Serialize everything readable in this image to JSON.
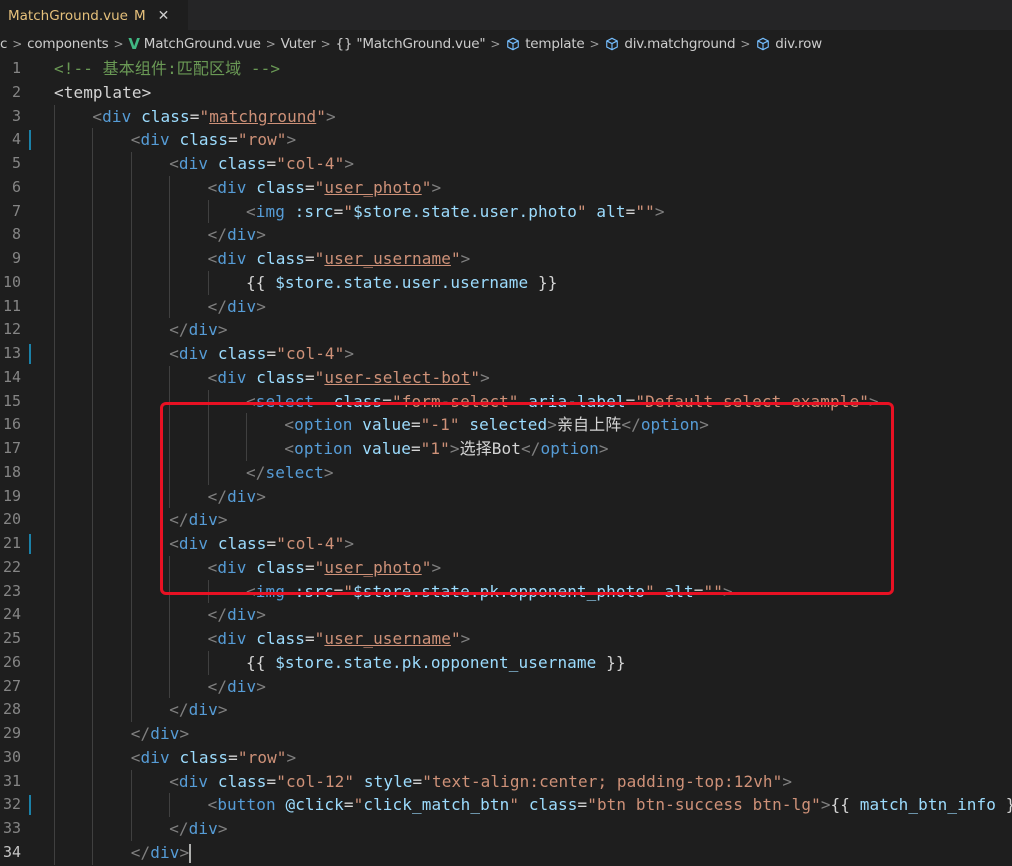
{
  "tab": {
    "title": "MatchGround.vue",
    "modified": "M",
    "close": "✕"
  },
  "breadcrumb": [
    {
      "label": "c",
      "icon": ""
    },
    {
      "label": "components",
      "icon": ""
    },
    {
      "label": "MatchGround.vue",
      "icon": "vue-icon"
    },
    {
      "label": "Vuter",
      "icon": ""
    },
    {
      "label": "\"MatchGround.vue\"",
      "icon": "braces-icon"
    },
    {
      "label": "template",
      "icon": "cube-icon"
    },
    {
      "label": "div.matchground",
      "icon": "cube-icon"
    },
    {
      "label": "div.row",
      "icon": "cube-icon"
    }
  ],
  "highlight_color": "#e81123",
  "active_line": 34,
  "lines": [
    {
      "n": 1,
      "indent": 0,
      "tokens": [
        [
          "comment",
          "<!-- 基本组件:匹配区域 -->"
        ]
      ]
    },
    {
      "n": 2,
      "indent": 0,
      "tokens": [
        [
          "tpl",
          "<template>"
        ]
      ]
    },
    {
      "n": 3,
      "indent": 1,
      "tokens": [
        [
          "bracket",
          "<"
        ],
        [
          "tag",
          "div"
        ],
        [
          "text",
          " "
        ],
        [
          "attr",
          "class"
        ],
        [
          "eq",
          "="
        ],
        [
          "str",
          "\""
        ],
        [
          "strU",
          "matchground"
        ],
        [
          "str",
          "\""
        ],
        [
          "bracket",
          ">"
        ]
      ]
    },
    {
      "n": 4,
      "indent": 2,
      "tokens": [
        [
          "bracket",
          "<"
        ],
        [
          "tag",
          "div"
        ],
        [
          "text",
          " "
        ],
        [
          "attr",
          "class"
        ],
        [
          "eq",
          "="
        ],
        [
          "str",
          "\"row\""
        ],
        [
          "bracket",
          ">"
        ]
      ]
    },
    {
      "n": 5,
      "indent": 3,
      "tokens": [
        [
          "bracket",
          "<"
        ],
        [
          "tag",
          "div"
        ],
        [
          "text",
          " "
        ],
        [
          "attr",
          "class"
        ],
        [
          "eq",
          "="
        ],
        [
          "str",
          "\"col-4\""
        ],
        [
          "bracket",
          ">"
        ]
      ]
    },
    {
      "n": 6,
      "indent": 4,
      "tokens": [
        [
          "bracket",
          "<"
        ],
        [
          "tag",
          "div"
        ],
        [
          "text",
          " "
        ],
        [
          "attr",
          "class"
        ],
        [
          "eq",
          "="
        ],
        [
          "str",
          "\""
        ],
        [
          "strU",
          "user_photo"
        ],
        [
          "str",
          "\""
        ],
        [
          "bracket",
          ">"
        ]
      ]
    },
    {
      "n": 7,
      "indent": 5,
      "tokens": [
        [
          "bracket",
          "<"
        ],
        [
          "tag",
          "img"
        ],
        [
          "text",
          " "
        ],
        [
          "attr",
          ":src"
        ],
        [
          "eq",
          "="
        ],
        [
          "str",
          "\""
        ],
        [
          "attr",
          "$store.state.user.photo"
        ],
        [
          "str",
          "\""
        ],
        [
          "text",
          " "
        ],
        [
          "attr",
          "alt"
        ],
        [
          "eq",
          "="
        ],
        [
          "str",
          "\"\""
        ],
        [
          "bracket",
          ">"
        ]
      ]
    },
    {
      "n": 8,
      "indent": 4,
      "tokens": [
        [
          "bracket",
          "</"
        ],
        [
          "tag",
          "div"
        ],
        [
          "bracket",
          ">"
        ]
      ]
    },
    {
      "n": 9,
      "indent": 4,
      "tokens": [
        [
          "bracket",
          "<"
        ],
        [
          "tag",
          "div"
        ],
        [
          "text",
          " "
        ],
        [
          "attr",
          "class"
        ],
        [
          "eq",
          "="
        ],
        [
          "str",
          "\""
        ],
        [
          "strU",
          "user_username"
        ],
        [
          "str",
          "\""
        ],
        [
          "bracket",
          ">"
        ]
      ]
    },
    {
      "n": 10,
      "indent": 5,
      "tokens": [
        [
          "text",
          "{{ "
        ],
        [
          "attr",
          "$store.state.user.username"
        ],
        [
          "text",
          " }}"
        ]
      ]
    },
    {
      "n": 11,
      "indent": 4,
      "tokens": [
        [
          "bracket",
          "</"
        ],
        [
          "tag",
          "div"
        ],
        [
          "bracket",
          ">"
        ]
      ]
    },
    {
      "n": 12,
      "indent": 3,
      "tokens": [
        [
          "bracket",
          "</"
        ],
        [
          "tag",
          "div"
        ],
        [
          "bracket",
          ">"
        ]
      ]
    },
    {
      "n": 13,
      "indent": 3,
      "tokens": [
        [
          "bracket",
          "<"
        ],
        [
          "tag",
          "div"
        ],
        [
          "text",
          " "
        ],
        [
          "attr",
          "class"
        ],
        [
          "eq",
          "="
        ],
        [
          "str",
          "\"col-4\""
        ],
        [
          "bracket",
          ">"
        ]
      ]
    },
    {
      "n": 14,
      "indent": 4,
      "tokens": [
        [
          "bracket",
          "<"
        ],
        [
          "tag",
          "div"
        ],
        [
          "text",
          " "
        ],
        [
          "attr",
          "class"
        ],
        [
          "eq",
          "="
        ],
        [
          "str",
          "\""
        ],
        [
          "strU",
          "user-select-bot"
        ],
        [
          "str",
          "\""
        ],
        [
          "bracket",
          ">"
        ]
      ]
    },
    {
      "n": 15,
      "indent": 5,
      "tokens": [
        [
          "bracket",
          "<"
        ],
        [
          "tag",
          "select"
        ],
        [
          "text",
          "  "
        ],
        [
          "attr",
          "class"
        ],
        [
          "eq",
          "="
        ],
        [
          "str",
          "\"form-select\""
        ],
        [
          "text",
          " "
        ],
        [
          "attr",
          "aria-label"
        ],
        [
          "eq",
          "="
        ],
        [
          "str",
          "\"Default select example\""
        ],
        [
          "bracket",
          ">"
        ]
      ]
    },
    {
      "n": 16,
      "indent": 6,
      "tokens": [
        [
          "bracket",
          "<"
        ],
        [
          "tag",
          "option"
        ],
        [
          "text",
          " "
        ],
        [
          "attr",
          "value"
        ],
        [
          "eq",
          "="
        ],
        [
          "str",
          "\"-1\""
        ],
        [
          "text",
          " "
        ],
        [
          "attr",
          "selected"
        ],
        [
          "bracket",
          ">"
        ],
        [
          "text",
          "亲自上阵"
        ],
        [
          "bracket",
          "</"
        ],
        [
          "tag",
          "option"
        ],
        [
          "bracket",
          ">"
        ]
      ]
    },
    {
      "n": 17,
      "indent": 6,
      "tokens": [
        [
          "bracket",
          "<"
        ],
        [
          "tag",
          "option"
        ],
        [
          "text",
          " "
        ],
        [
          "attr",
          "value"
        ],
        [
          "eq",
          "="
        ],
        [
          "str",
          "\"1\""
        ],
        [
          "bracket",
          ">"
        ],
        [
          "text",
          "选择Bot"
        ],
        [
          "bracket",
          "</"
        ],
        [
          "tag",
          "option"
        ],
        [
          "bracket",
          ">"
        ]
      ]
    },
    {
      "n": 18,
      "indent": 5,
      "tokens": [
        [
          "bracket",
          "</"
        ],
        [
          "tag",
          "select"
        ],
        [
          "bracket",
          ">"
        ]
      ]
    },
    {
      "n": 19,
      "indent": 4,
      "tokens": [
        [
          "bracket",
          "</"
        ],
        [
          "tag",
          "div"
        ],
        [
          "bracket",
          ">"
        ]
      ]
    },
    {
      "n": 20,
      "indent": 3,
      "tokens": [
        [
          "bracket",
          "</"
        ],
        [
          "tag",
          "div"
        ],
        [
          "bracket",
          ">"
        ]
      ]
    },
    {
      "n": 21,
      "indent": 3,
      "tokens": [
        [
          "bracket",
          "<"
        ],
        [
          "tag",
          "div"
        ],
        [
          "text",
          " "
        ],
        [
          "attr",
          "class"
        ],
        [
          "eq",
          "="
        ],
        [
          "str",
          "\"col-4\""
        ],
        [
          "bracket",
          ">"
        ]
      ]
    },
    {
      "n": 22,
      "indent": 4,
      "tokens": [
        [
          "bracket",
          "<"
        ],
        [
          "tag",
          "div"
        ],
        [
          "text",
          " "
        ],
        [
          "attr",
          "class"
        ],
        [
          "eq",
          "="
        ],
        [
          "str",
          "\""
        ],
        [
          "strU",
          "user_photo"
        ],
        [
          "str",
          "\""
        ],
        [
          "bracket",
          ">"
        ]
      ]
    },
    {
      "n": 23,
      "indent": 5,
      "tokens": [
        [
          "bracket",
          "<"
        ],
        [
          "tag",
          "img"
        ],
        [
          "text",
          " "
        ],
        [
          "attr",
          ":src"
        ],
        [
          "eq",
          "="
        ],
        [
          "str",
          "\""
        ],
        [
          "attr",
          "$store.state.pk.opponent_photo"
        ],
        [
          "str",
          "\""
        ],
        [
          "text",
          " "
        ],
        [
          "attr",
          "alt"
        ],
        [
          "eq",
          "="
        ],
        [
          "str",
          "\"\""
        ],
        [
          "bracket",
          ">"
        ]
      ]
    },
    {
      "n": 24,
      "indent": 4,
      "tokens": [
        [
          "bracket",
          "</"
        ],
        [
          "tag",
          "div"
        ],
        [
          "bracket",
          ">"
        ]
      ]
    },
    {
      "n": 25,
      "indent": 4,
      "tokens": [
        [
          "bracket",
          "<"
        ],
        [
          "tag",
          "div"
        ],
        [
          "text",
          " "
        ],
        [
          "attr",
          "class"
        ],
        [
          "eq",
          "="
        ],
        [
          "str",
          "\""
        ],
        [
          "strU",
          "user_username"
        ],
        [
          "str",
          "\""
        ],
        [
          "bracket",
          ">"
        ]
      ]
    },
    {
      "n": 26,
      "indent": 5,
      "tokens": [
        [
          "text",
          "{{ "
        ],
        [
          "attr",
          "$store.state.pk.opponent_username"
        ],
        [
          "text",
          " }}"
        ]
      ]
    },
    {
      "n": 27,
      "indent": 4,
      "tokens": [
        [
          "bracket",
          "</"
        ],
        [
          "tag",
          "div"
        ],
        [
          "bracket",
          ">"
        ]
      ]
    },
    {
      "n": 28,
      "indent": 3,
      "tokens": [
        [
          "bracket",
          "</"
        ],
        [
          "tag",
          "div"
        ],
        [
          "bracket",
          ">"
        ]
      ]
    },
    {
      "n": 29,
      "indent": 2,
      "tokens": [
        [
          "bracket",
          "</"
        ],
        [
          "tag",
          "div"
        ],
        [
          "bracket",
          ">"
        ]
      ]
    },
    {
      "n": 30,
      "indent": 2,
      "tokens": [
        [
          "bracket",
          "<"
        ],
        [
          "tag",
          "div"
        ],
        [
          "text",
          " "
        ],
        [
          "attr",
          "class"
        ],
        [
          "eq",
          "="
        ],
        [
          "str",
          "\"row\""
        ],
        [
          "bracket",
          ">"
        ]
      ]
    },
    {
      "n": 31,
      "indent": 3,
      "tokens": [
        [
          "bracket",
          "<"
        ],
        [
          "tag",
          "div"
        ],
        [
          "text",
          " "
        ],
        [
          "attr",
          "class"
        ],
        [
          "eq",
          "="
        ],
        [
          "str",
          "\"col-12\""
        ],
        [
          "text",
          " "
        ],
        [
          "attr",
          "style"
        ],
        [
          "eq",
          "="
        ],
        [
          "str",
          "\"text-align:center; padding-top:12vh\""
        ],
        [
          "bracket",
          ">"
        ]
      ]
    },
    {
      "n": 32,
      "indent": 4,
      "tokens": [
        [
          "bracket",
          "<"
        ],
        [
          "tag",
          "button"
        ],
        [
          "text",
          " "
        ],
        [
          "attr",
          "@click"
        ],
        [
          "eq",
          "="
        ],
        [
          "str",
          "\""
        ],
        [
          "attr",
          "click_match_btn"
        ],
        [
          "str",
          "\""
        ],
        [
          "text",
          " "
        ],
        [
          "attr",
          "class"
        ],
        [
          "eq",
          "="
        ],
        [
          "str",
          "\"btn btn-success btn-lg\""
        ],
        [
          "bracket",
          ">"
        ],
        [
          "text",
          "{{ "
        ],
        [
          "attr",
          "match_btn_info"
        ],
        [
          "text",
          " }}"
        ]
      ]
    },
    {
      "n": 33,
      "indent": 3,
      "tokens": [
        [
          "bracket",
          "</"
        ],
        [
          "tag",
          "div"
        ],
        [
          "bracket",
          ">"
        ]
      ]
    },
    {
      "n": 34,
      "indent": 2,
      "tokens": [
        [
          "bracket",
          "</"
        ],
        [
          "tag",
          "div"
        ],
        [
          "bracket",
          ">"
        ]
      ]
    }
  ]
}
